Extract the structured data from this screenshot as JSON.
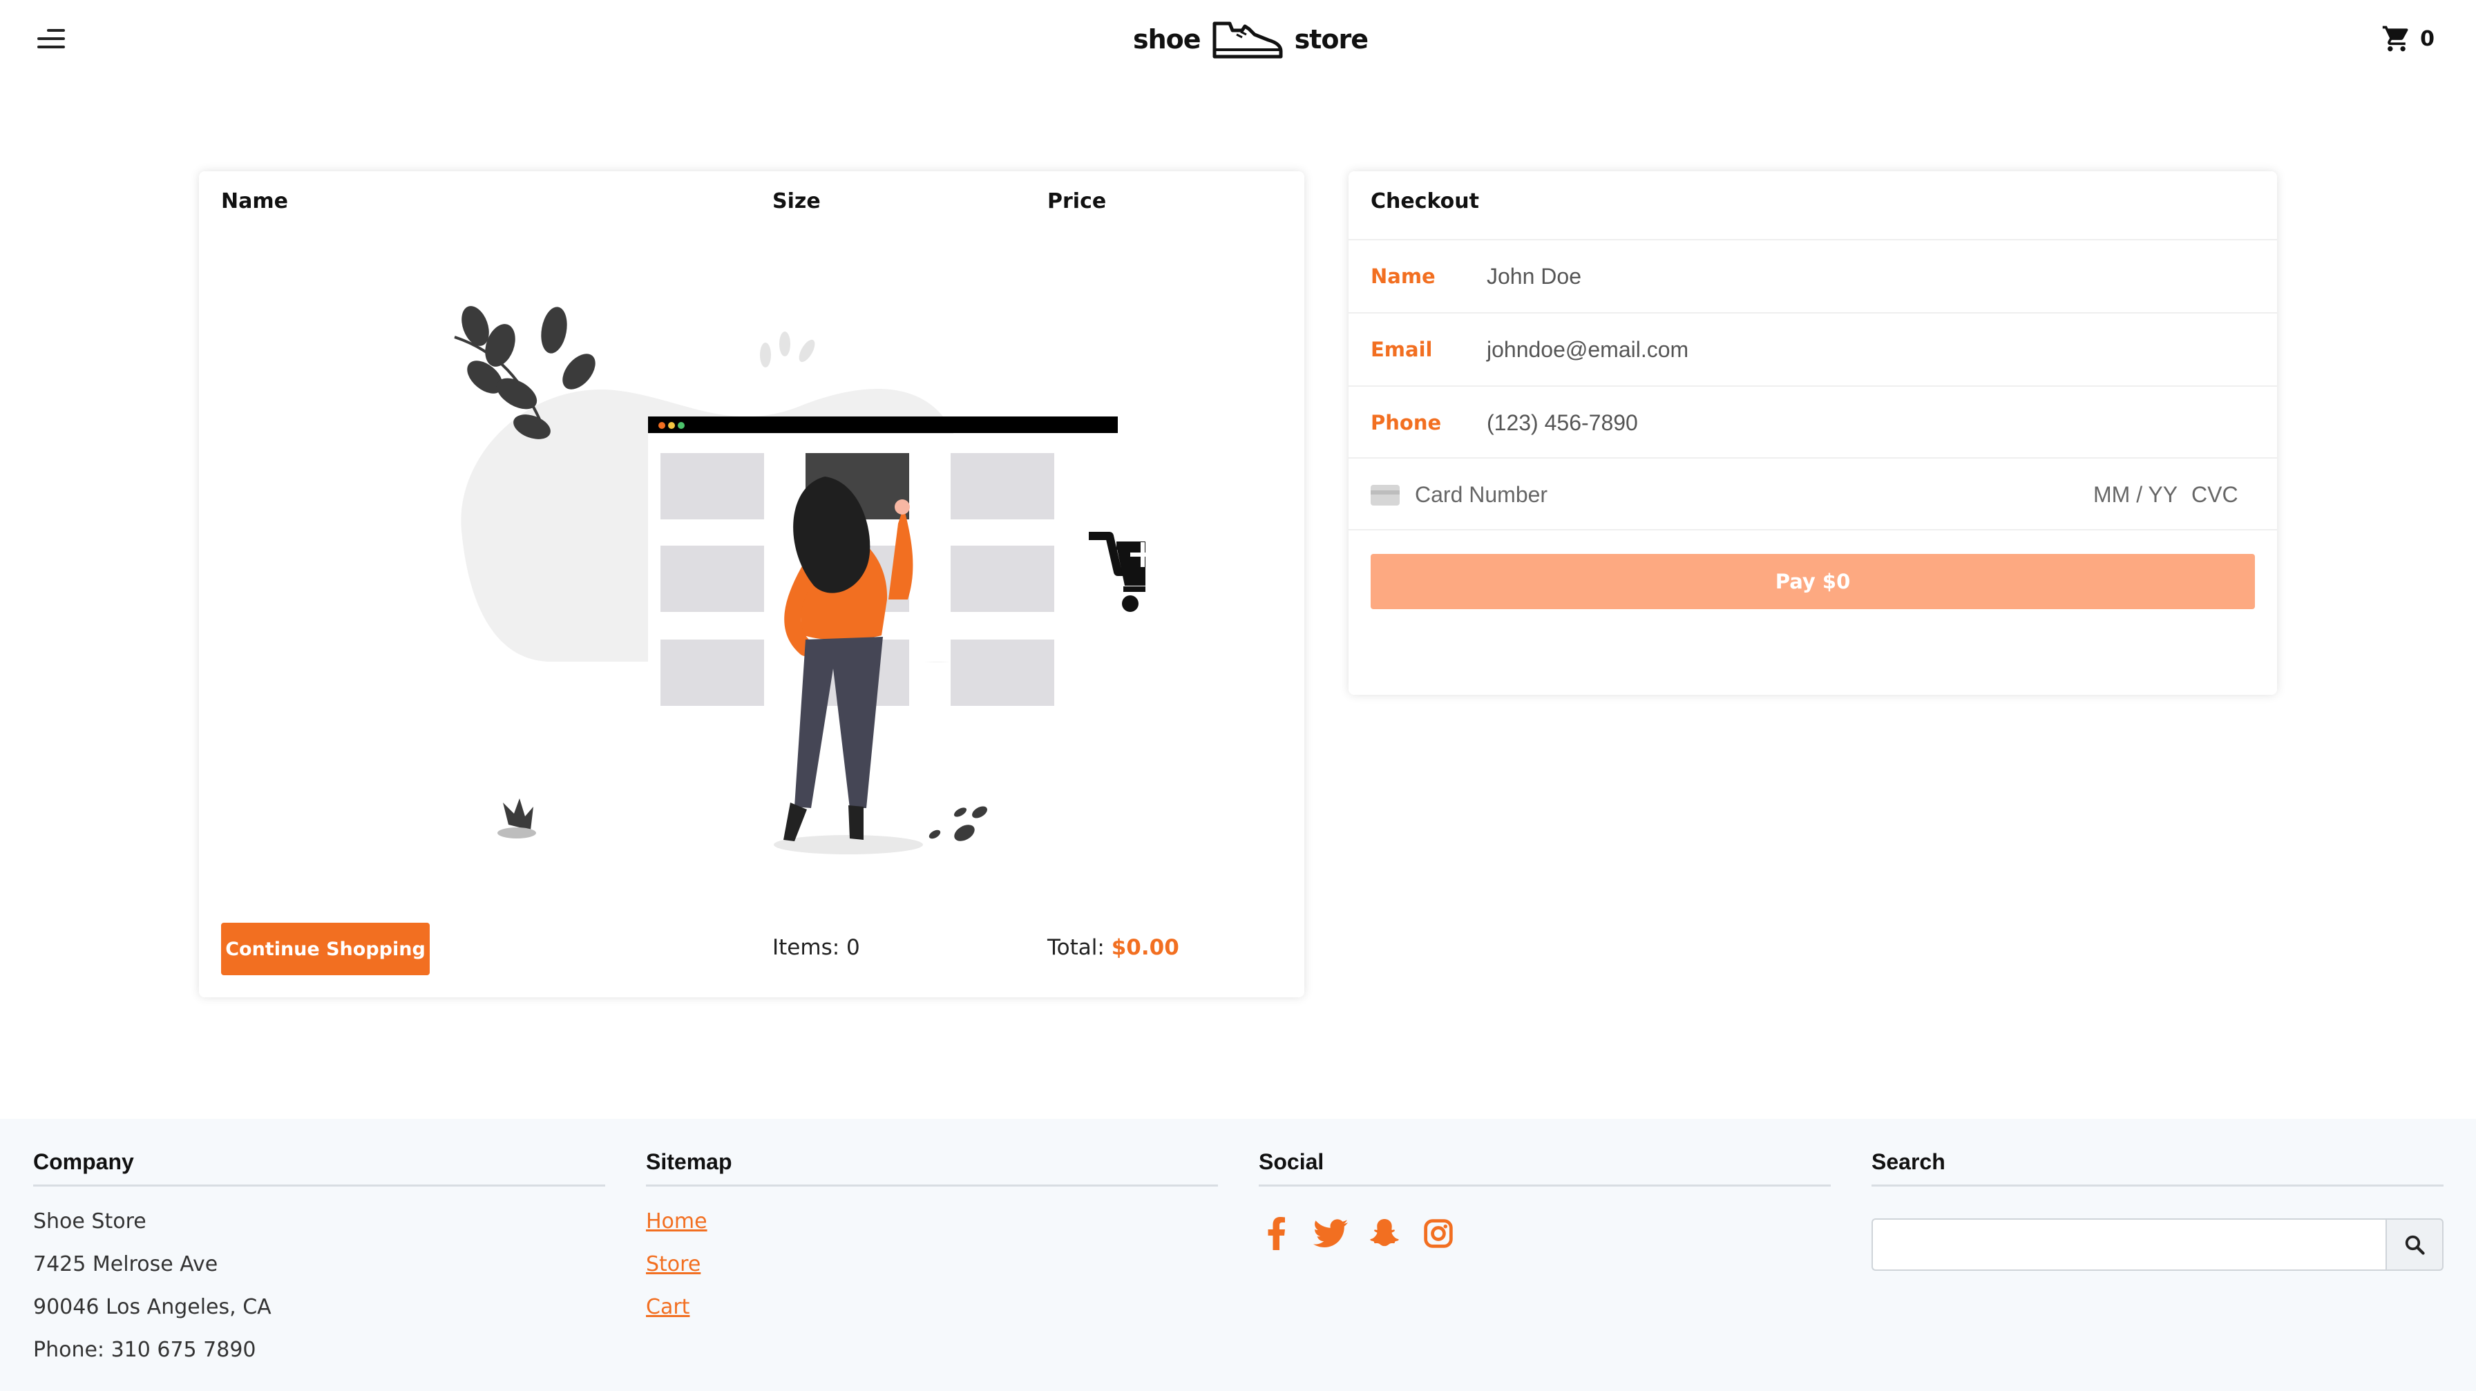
{
  "header": {
    "logo_left": "shoe",
    "logo_right": "store",
    "cart_count": "0"
  },
  "cart": {
    "columns": [
      "Name",
      "Size",
      "Price"
    ],
    "continue_label": "Continue Shopping",
    "items_label": "Items: 0",
    "total_label": "Total:",
    "total_value": "$0.00"
  },
  "checkout": {
    "title": "Checkout",
    "fields": [
      {
        "label": "Name",
        "value": "John Doe"
      },
      {
        "label": "Email",
        "value": "johndoe@email.com"
      },
      {
        "label": "Phone",
        "value": "(123) 456-7890"
      }
    ],
    "card_number_placeholder": "Card Number",
    "card_expiry_placeholder": "MM / YY",
    "card_cvc_placeholder": "CVC",
    "pay_label": "Pay $0"
  },
  "footer": {
    "company": {
      "title": "Company",
      "lines": [
        "Shoe Store",
        "7425 Melrose Ave",
        "90046 Los Angeles, CA",
        "Phone: 310 675 7890"
      ]
    },
    "sitemap": {
      "title": "Sitemap",
      "links": [
        "Home",
        "Store",
        "Cart"
      ]
    },
    "social": {
      "title": "Social",
      "icons": [
        "facebook-icon",
        "twitter-icon",
        "snapchat-icon",
        "instagram-icon"
      ]
    },
    "search": {
      "title": "Search",
      "placeholder": ""
    }
  },
  "colors": {
    "accent": "#f26f21",
    "pay_button": "#fda981",
    "footer_bg": "#f6f9fc"
  }
}
